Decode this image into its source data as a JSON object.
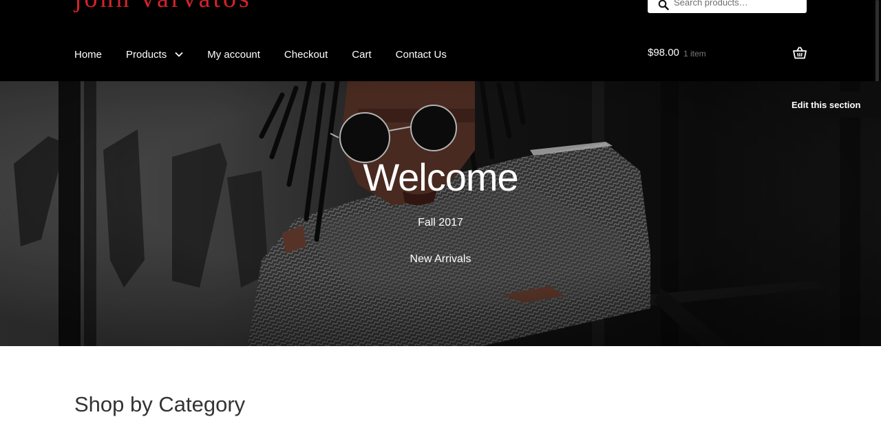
{
  "site": {
    "logo_text": "john varvatos"
  },
  "search": {
    "placeholder": "Search products…"
  },
  "nav": {
    "items": [
      {
        "label": "Home"
      },
      {
        "label": "Products"
      },
      {
        "label": "My account"
      },
      {
        "label": "Checkout"
      },
      {
        "label": "Cart"
      },
      {
        "label": "Contact Us"
      }
    ]
  },
  "cart": {
    "total": "$98.00",
    "count": "1 item"
  },
  "hero": {
    "title": "Welcome",
    "subtitle": "Fall 2017",
    "tagline": "New Arrivals",
    "edit_label": "Edit this section"
  },
  "content": {
    "section_title": "Shop by Category"
  },
  "colors": {
    "header_bg": "#000000",
    "logo": "#d2232a",
    "text_light": "#ffffff",
    "muted": "#7a7a7a"
  },
  "icons": {
    "search": "search-icon",
    "dropdown": "chevron-down-icon",
    "cart": "basket-icon"
  }
}
